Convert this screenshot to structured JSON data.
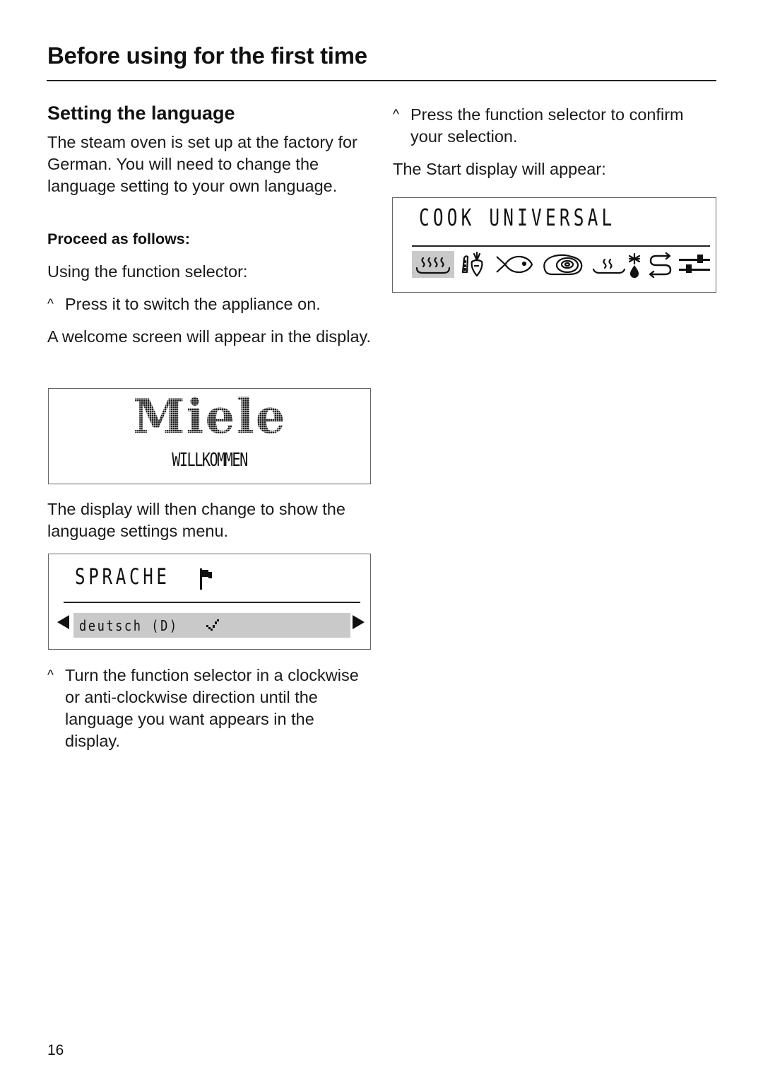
{
  "header": {
    "title": "Before using for the first time"
  },
  "left_column": {
    "section_heading": "Setting the language",
    "intro": "The steam oven is set up at the factory for German. You will need to change the language setting to your own language.",
    "proceed_heading": "Proceed as follows:",
    "using_selector": "Using the function selector:",
    "step_switch_on": {
      "bullet": "^",
      "text": "Press it to switch the appliance on."
    },
    "welcome_note": "A welcome screen will appear in the display.",
    "menu_note": "The display will then change to show the language settings menu.",
    "step_turn": {
      "bullet": "^",
      "text": "Turn the function selector in a clockwise or anti-clockwise direction until the language you want appears in the display."
    }
  },
  "welcome_display": {
    "logo": "Miele",
    "message": "WILLKOMMEN"
  },
  "language_display": {
    "title": "SPRACHE",
    "title_icon": "flag-icon",
    "selected_option": "deutsch (D)",
    "selected_indicator": "check-icon",
    "nav_left_icon": "arrow-left-icon",
    "nav_right_icon": "arrow-right-icon"
  },
  "right_column": {
    "step_confirm": {
      "bullet": "^",
      "text": "Press the function selector to confirm your selection."
    },
    "start_note": "The Start display will appear:"
  },
  "start_display": {
    "title": "COOK UNIVERSAL",
    "icons": [
      {
        "name": "steam-cooking-icon",
        "selected": true
      },
      {
        "name": "vegetables-icon",
        "selected": false
      },
      {
        "name": "fish-icon",
        "selected": false
      },
      {
        "name": "meat-icon",
        "selected": false
      },
      {
        "name": "reheat-icon",
        "selected": false
      },
      {
        "name": "defrost-icon",
        "selected": false
      },
      {
        "name": "programs-cycle-icon",
        "selected": false
      },
      {
        "name": "settings-sliders-icon",
        "selected": false
      }
    ],
    "highlight_color": "#c9c9c9"
  },
  "footer": {
    "page_number": "16"
  }
}
